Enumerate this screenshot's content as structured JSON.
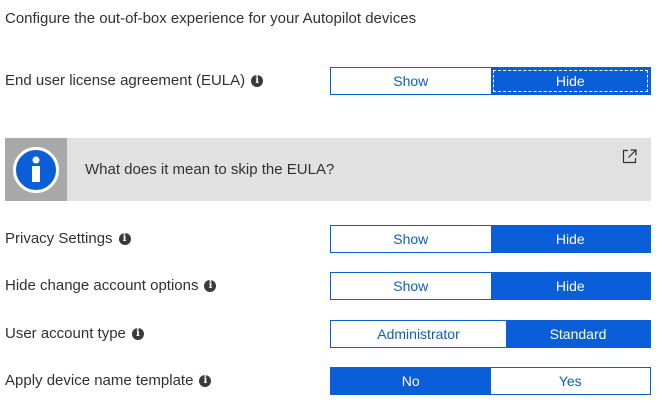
{
  "heading": "Configure the out-of-box experience for your Autopilot devices",
  "banner": {
    "text": "What does it mean to skip the EULA?",
    "icon": "info-icon",
    "link_icon": "external-link-icon"
  },
  "settings": [
    {
      "label": "End user license agreement (EULA)",
      "options": [
        "Show",
        "Hide"
      ],
      "selected": "Hide"
    },
    {
      "label": "Privacy Settings",
      "options": [
        "Show",
        "Hide"
      ],
      "selected": "Hide"
    },
    {
      "label": "Hide change account options",
      "options": [
        "Show",
        "Hide"
      ],
      "selected": "Hide"
    },
    {
      "label": "User account type",
      "options": [
        "Administrator",
        "Standard"
      ],
      "selected": "Standard"
    },
    {
      "label": "Apply device name template",
      "options": [
        "No",
        "Yes"
      ],
      "selected": "No"
    }
  ],
  "colors": {
    "accent": "#0a5ed7",
    "banner_bg": "#e1e1e1",
    "icon_box_bg": "#a8a8a8"
  }
}
